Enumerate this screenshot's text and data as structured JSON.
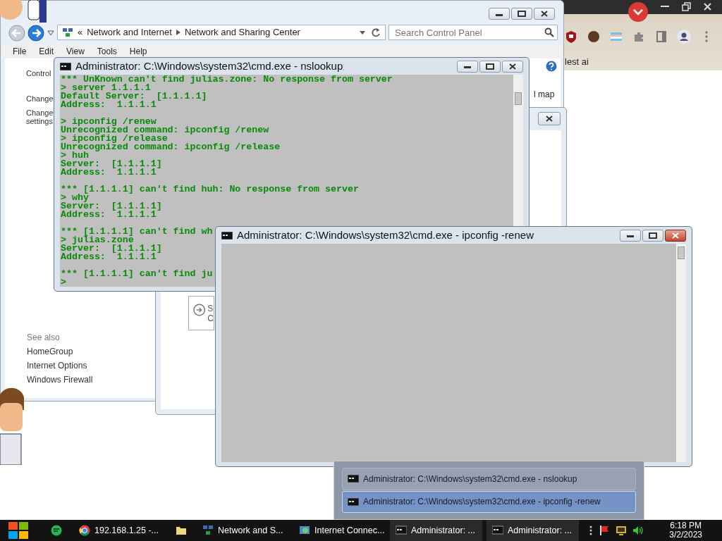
{
  "browser": {
    "bookmark_text": "lest ai"
  },
  "control_panel": {
    "breadcrumb_prefix": "«",
    "breadcrumb": [
      "Network and Internet",
      "Network and Sharing Center"
    ],
    "search": {
      "placeholder": "Search Control Panel"
    },
    "menu": [
      "File",
      "Edit",
      "View",
      "Tools",
      "Help"
    ],
    "left_pane": [
      "Control",
      "Change",
      "Change",
      "settings"
    ],
    "map_link": "l map",
    "see_also_title": "See also",
    "see_also": [
      "HomeGroup",
      "Internet Options",
      "Windows Firewall"
    ]
  },
  "dialog": {
    "option_letters": [
      "S",
      "C"
    ]
  },
  "console_windows": [
    {
      "title": "Administrator: C:\\Windows\\system32\\cmd.exe - nslookup",
      "blocks": [
        [
          "*** UnKnown can't find julias.zone: No response from server",
          "> server 1.1.1.1",
          "Default Server:  [1.1.1.1]",
          "Address:  1.1.1.1"
        ],
        [
          "> ipconfig /renew",
          "Unrecognized command: ipconfig /renew",
          "> ipconfig /release",
          "Unrecognized command: ipconfig /release",
          "> huh",
          "Server:  [1.1.1.1]",
          "Address:  1.1.1.1"
        ],
        [
          "*** [1.1.1.1] can't find huh: No response from server",
          "> why",
          "Server:  [1.1.1.1]",
          "Address:  1.1.1.1"
        ],
        [
          "*** [1.1.1.1] can't find wh",
          "> julias.zone",
          "Server:  [1.1.1.1]",
          "Address:  1.1.1.1"
        ],
        [
          "*** [1.1.1.1] can't find ju",
          ">"
        ]
      ]
    },
    {
      "title": "Administrator: C:\\Windows\\system32\\cmd.exe - ipconfig  -renew"
    }
  ],
  "taskbar_preview": [
    {
      "title": "Administrator: C:\\Windows\\system32\\cmd.exe - nslookup",
      "selected": false
    },
    {
      "title": "Administrator: C:\\Windows\\system32\\cmd.exe - ipconfig  -renew",
      "selected": true
    }
  ],
  "taskbar": {
    "items": [
      {
        "kind": "browser",
        "label": "192.168.1.25 -..."
      },
      {
        "kind": "folder"
      },
      {
        "kind": "control-panel",
        "label": "Network and S..."
      },
      {
        "kind": "network",
        "label": "Internet Connec..."
      },
      {
        "kind": "console",
        "label": "Administrator: ..."
      },
      {
        "kind": "console",
        "label": "Administrator: ..."
      }
    ],
    "time": "6:18 PM",
    "date": "3/2/2023"
  }
}
